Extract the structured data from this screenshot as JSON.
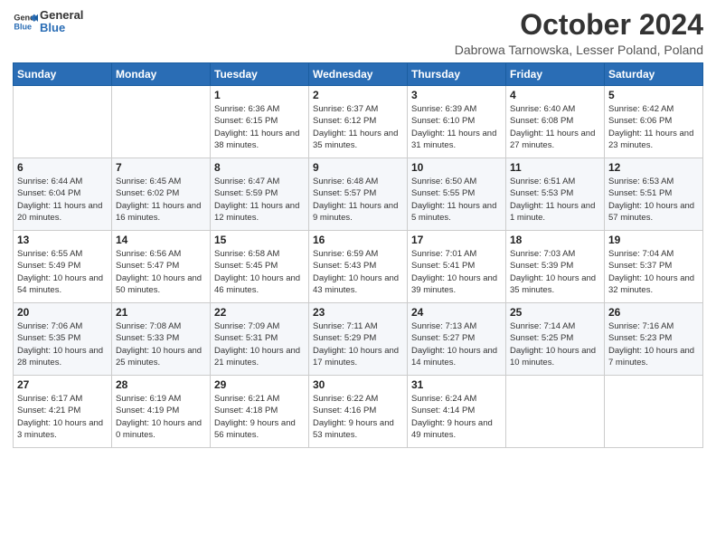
{
  "header": {
    "logo_line1": "General",
    "logo_line2": "Blue",
    "month": "October 2024",
    "location": "Dabrowa Tarnowska, Lesser Poland, Poland"
  },
  "days_of_week": [
    "Sunday",
    "Monday",
    "Tuesday",
    "Wednesday",
    "Thursday",
    "Friday",
    "Saturday"
  ],
  "weeks": [
    [
      {
        "day": "",
        "sunrise": "",
        "sunset": "",
        "daylight": ""
      },
      {
        "day": "",
        "sunrise": "",
        "sunset": "",
        "daylight": ""
      },
      {
        "day": "1",
        "sunrise": "Sunrise: 6:36 AM",
        "sunset": "Sunset: 6:15 PM",
        "daylight": "Daylight: 11 hours and 38 minutes."
      },
      {
        "day": "2",
        "sunrise": "Sunrise: 6:37 AM",
        "sunset": "Sunset: 6:12 PM",
        "daylight": "Daylight: 11 hours and 35 minutes."
      },
      {
        "day": "3",
        "sunrise": "Sunrise: 6:39 AM",
        "sunset": "Sunset: 6:10 PM",
        "daylight": "Daylight: 11 hours and 31 minutes."
      },
      {
        "day": "4",
        "sunrise": "Sunrise: 6:40 AM",
        "sunset": "Sunset: 6:08 PM",
        "daylight": "Daylight: 11 hours and 27 minutes."
      },
      {
        "day": "5",
        "sunrise": "Sunrise: 6:42 AM",
        "sunset": "Sunset: 6:06 PM",
        "daylight": "Daylight: 11 hours and 23 minutes."
      }
    ],
    [
      {
        "day": "6",
        "sunrise": "Sunrise: 6:44 AM",
        "sunset": "Sunset: 6:04 PM",
        "daylight": "Daylight: 11 hours and 20 minutes."
      },
      {
        "day": "7",
        "sunrise": "Sunrise: 6:45 AM",
        "sunset": "Sunset: 6:02 PM",
        "daylight": "Daylight: 11 hours and 16 minutes."
      },
      {
        "day": "8",
        "sunrise": "Sunrise: 6:47 AM",
        "sunset": "Sunset: 5:59 PM",
        "daylight": "Daylight: 11 hours and 12 minutes."
      },
      {
        "day": "9",
        "sunrise": "Sunrise: 6:48 AM",
        "sunset": "Sunset: 5:57 PM",
        "daylight": "Daylight: 11 hours and 9 minutes."
      },
      {
        "day": "10",
        "sunrise": "Sunrise: 6:50 AM",
        "sunset": "Sunset: 5:55 PM",
        "daylight": "Daylight: 11 hours and 5 minutes."
      },
      {
        "day": "11",
        "sunrise": "Sunrise: 6:51 AM",
        "sunset": "Sunset: 5:53 PM",
        "daylight": "Daylight: 11 hours and 1 minute."
      },
      {
        "day": "12",
        "sunrise": "Sunrise: 6:53 AM",
        "sunset": "Sunset: 5:51 PM",
        "daylight": "Daylight: 10 hours and 57 minutes."
      }
    ],
    [
      {
        "day": "13",
        "sunrise": "Sunrise: 6:55 AM",
        "sunset": "Sunset: 5:49 PM",
        "daylight": "Daylight: 10 hours and 54 minutes."
      },
      {
        "day": "14",
        "sunrise": "Sunrise: 6:56 AM",
        "sunset": "Sunset: 5:47 PM",
        "daylight": "Daylight: 10 hours and 50 minutes."
      },
      {
        "day": "15",
        "sunrise": "Sunrise: 6:58 AM",
        "sunset": "Sunset: 5:45 PM",
        "daylight": "Daylight: 10 hours and 46 minutes."
      },
      {
        "day": "16",
        "sunrise": "Sunrise: 6:59 AM",
        "sunset": "Sunset: 5:43 PM",
        "daylight": "Daylight: 10 hours and 43 minutes."
      },
      {
        "day": "17",
        "sunrise": "Sunrise: 7:01 AM",
        "sunset": "Sunset: 5:41 PM",
        "daylight": "Daylight: 10 hours and 39 minutes."
      },
      {
        "day": "18",
        "sunrise": "Sunrise: 7:03 AM",
        "sunset": "Sunset: 5:39 PM",
        "daylight": "Daylight: 10 hours and 35 minutes."
      },
      {
        "day": "19",
        "sunrise": "Sunrise: 7:04 AM",
        "sunset": "Sunset: 5:37 PM",
        "daylight": "Daylight: 10 hours and 32 minutes."
      }
    ],
    [
      {
        "day": "20",
        "sunrise": "Sunrise: 7:06 AM",
        "sunset": "Sunset: 5:35 PM",
        "daylight": "Daylight: 10 hours and 28 minutes."
      },
      {
        "day": "21",
        "sunrise": "Sunrise: 7:08 AM",
        "sunset": "Sunset: 5:33 PM",
        "daylight": "Daylight: 10 hours and 25 minutes."
      },
      {
        "day": "22",
        "sunrise": "Sunrise: 7:09 AM",
        "sunset": "Sunset: 5:31 PM",
        "daylight": "Daylight: 10 hours and 21 minutes."
      },
      {
        "day": "23",
        "sunrise": "Sunrise: 7:11 AM",
        "sunset": "Sunset: 5:29 PM",
        "daylight": "Daylight: 10 hours and 17 minutes."
      },
      {
        "day": "24",
        "sunrise": "Sunrise: 7:13 AM",
        "sunset": "Sunset: 5:27 PM",
        "daylight": "Daylight: 10 hours and 14 minutes."
      },
      {
        "day": "25",
        "sunrise": "Sunrise: 7:14 AM",
        "sunset": "Sunset: 5:25 PM",
        "daylight": "Daylight: 10 hours and 10 minutes."
      },
      {
        "day": "26",
        "sunrise": "Sunrise: 7:16 AM",
        "sunset": "Sunset: 5:23 PM",
        "daylight": "Daylight: 10 hours and 7 minutes."
      }
    ],
    [
      {
        "day": "27",
        "sunrise": "Sunrise: 6:17 AM",
        "sunset": "Sunset: 4:21 PM",
        "daylight": "Daylight: 10 hours and 3 minutes."
      },
      {
        "day": "28",
        "sunrise": "Sunrise: 6:19 AM",
        "sunset": "Sunset: 4:19 PM",
        "daylight": "Daylight: 10 hours and 0 minutes."
      },
      {
        "day": "29",
        "sunrise": "Sunrise: 6:21 AM",
        "sunset": "Sunset: 4:18 PM",
        "daylight": "Daylight: 9 hours and 56 minutes."
      },
      {
        "day": "30",
        "sunrise": "Sunrise: 6:22 AM",
        "sunset": "Sunset: 4:16 PM",
        "daylight": "Daylight: 9 hours and 53 minutes."
      },
      {
        "day": "31",
        "sunrise": "Sunrise: 6:24 AM",
        "sunset": "Sunset: 4:14 PM",
        "daylight": "Daylight: 9 hours and 49 minutes."
      },
      {
        "day": "",
        "sunrise": "",
        "sunset": "",
        "daylight": ""
      },
      {
        "day": "",
        "sunrise": "",
        "sunset": "",
        "daylight": ""
      }
    ]
  ]
}
